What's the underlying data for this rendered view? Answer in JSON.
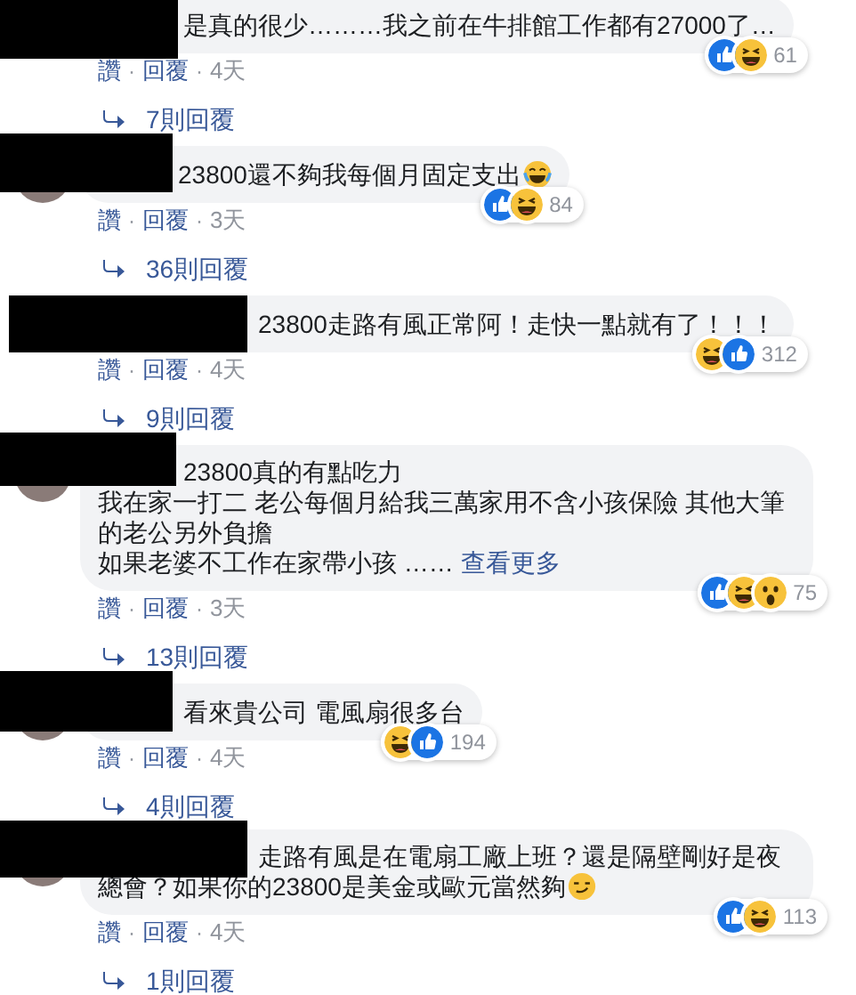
{
  "separator": "·",
  "comments": [
    {
      "paragraphs": [
        "是真的很少………我之前在牛排館工作都有27000了…"
      ],
      "reactions": [
        {
          "kind": "like"
        },
        {
          "kind": "haha"
        }
      ],
      "reaction_count": "61",
      "like": "讚",
      "reply": "回覆",
      "time": "4天",
      "replies": "7則回覆"
    },
    {
      "paragraphs": [
        "23800還不夠我每個月固定支出"
      ],
      "emoji": {
        "kind": "tears-of-joy"
      },
      "reactions": [
        {
          "kind": "like"
        },
        {
          "kind": "haha"
        }
      ],
      "reaction_count": "84",
      "like": "讚",
      "reply": "回覆",
      "time": "3天",
      "replies": "36則回覆"
    },
    {
      "paragraphs": [
        "23800走路有風正常阿！走快一點就有了！！！"
      ],
      "reactions": [
        {
          "kind": "haha"
        },
        {
          "kind": "like"
        }
      ],
      "reaction_count": "312",
      "like": "讚",
      "reply": "回覆",
      "time": "4天",
      "replies": "9則回覆"
    },
    {
      "paragraphs": [
        "23800真的有點吃力",
        "我在家一打二 老公每個月給我三萬家用不含小孩保險 其他大筆的老公另外負擔",
        "如果老婆不工作在家帶小孩 ……"
      ],
      "see_more": "查看更多",
      "reactions": [
        {
          "kind": "like"
        },
        {
          "kind": "haha"
        },
        {
          "kind": "wow"
        }
      ],
      "reaction_count": "75",
      "like": "讚",
      "reply": "回覆",
      "time": "3天",
      "replies": "13則回覆"
    },
    {
      "paragraphs": [
        "看來貴公司 電風扇很多台"
      ],
      "reactions": [
        {
          "kind": "haha"
        },
        {
          "kind": "like"
        }
      ],
      "reaction_count": "194",
      "like": "讚",
      "reply": "回覆",
      "time": "4天",
      "replies": "4則回覆"
    },
    {
      "paragraphs": [
        "走路有風是在電扇工廠上班？還是隔壁剛好是夜總會？如果你的23800是美金或歐元當然夠"
      ],
      "emoji": {
        "kind": "smirk"
      },
      "reactions": [
        {
          "kind": "like"
        },
        {
          "kind": "haha"
        }
      ],
      "reaction_count": "113",
      "like": "讚",
      "reply": "回覆",
      "time": "4天",
      "replies": "1則回覆"
    }
  ]
}
